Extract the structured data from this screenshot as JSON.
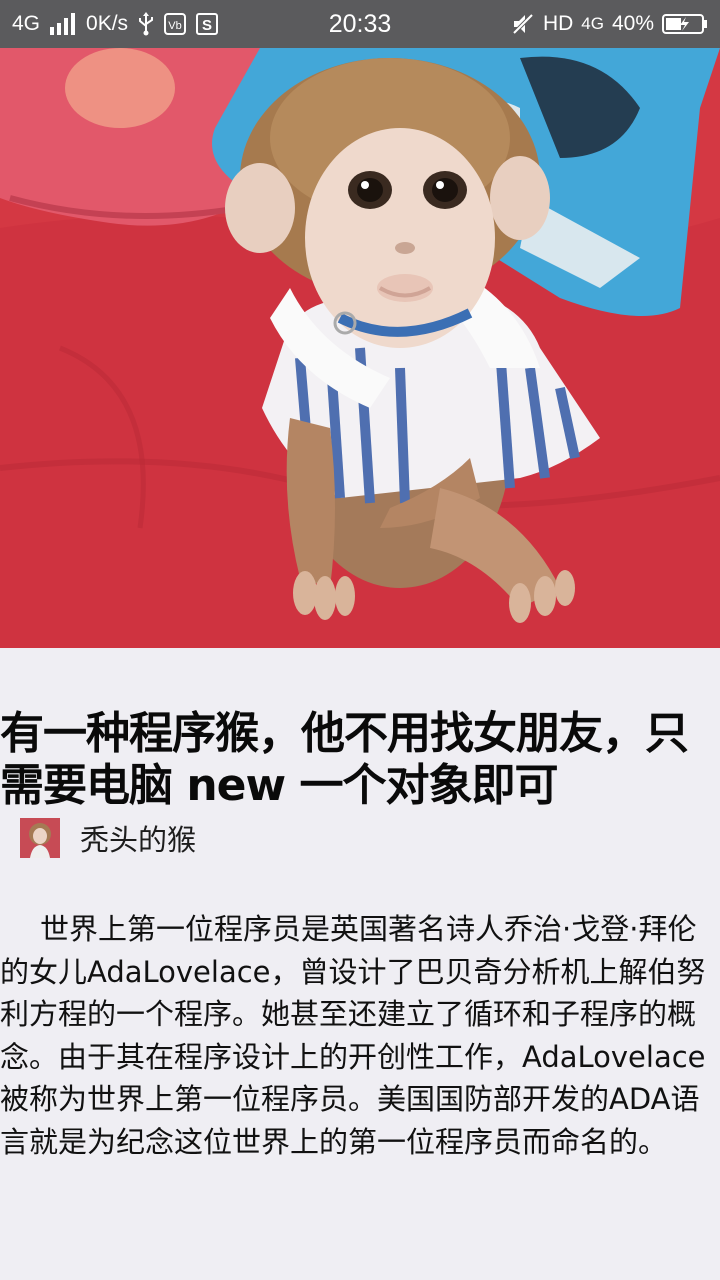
{
  "status_bar": {
    "network": "4G",
    "speed": "0K/s",
    "time": "20:33",
    "hd": "HD",
    "network_right": "4G",
    "battery": "40%",
    "colors": {
      "background": "#5b5b5d",
      "text": "#ffffff"
    }
  },
  "hero": {
    "image_name": "monkey-photo"
  },
  "article": {
    "title": "有一种程序猴，他不用找女朋友，只需要电脑 new 一个对象即可",
    "author": "秃头的猴",
    "body": "世界上第一位程序员是英国著名诗人乔治·戈登·拜伦的女儿AdaLovelace，曾设计了巴贝奇分析机上解伯努利方程的一个程序。她甚至还建立了循环和子程序的概念。由于其在程序设计上的开创性工作，AdaLovelace被称为世界上第一位程序员。美国国防部开发的ADA语言就是为纪念这位世界上的第一位程序员而命名的。"
  }
}
